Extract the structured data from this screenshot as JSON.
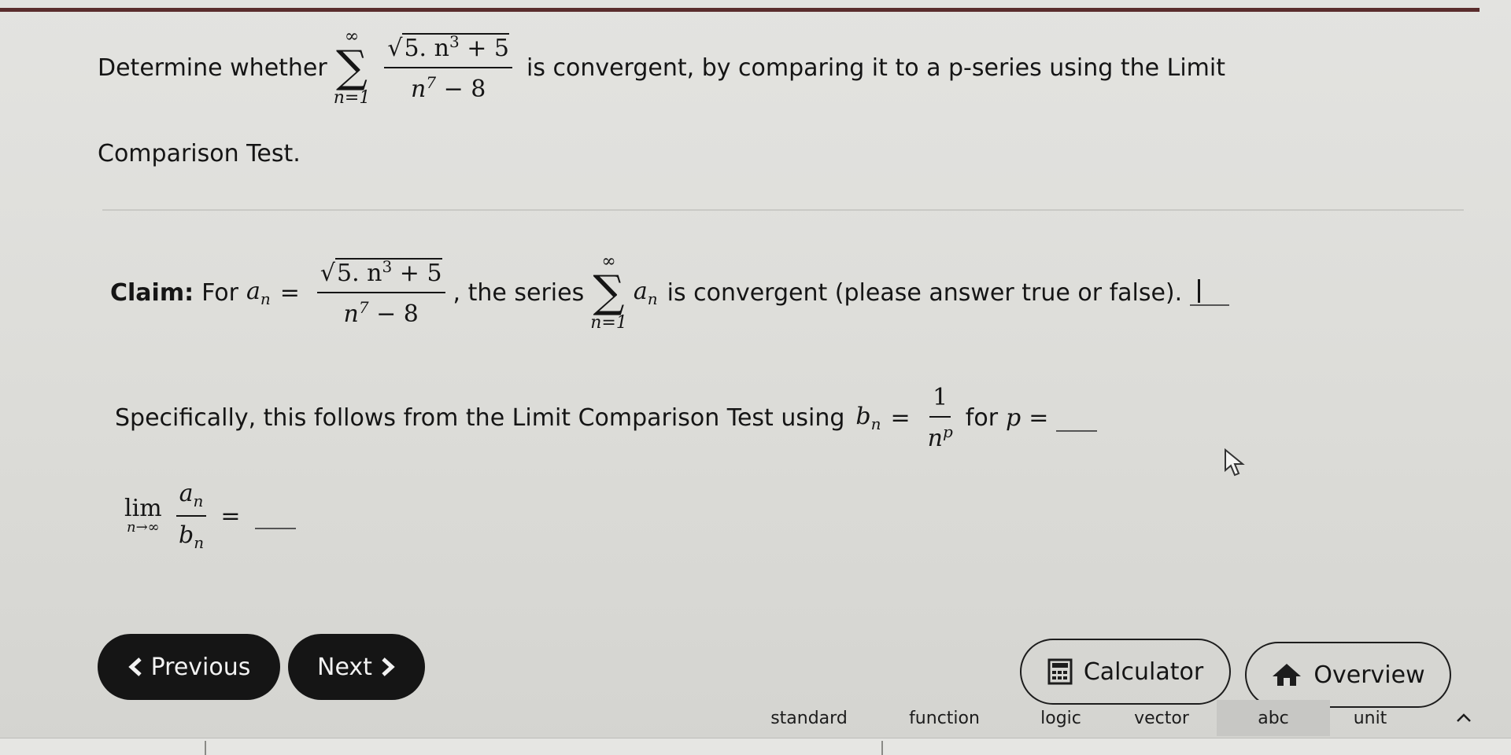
{
  "question": {
    "prefix": "Determine whether",
    "sum_upper": "∞",
    "sum_lower": "n=1",
    "term_numerator": "5. n",
    "term_numerator_exp": "3",
    "term_numerator_tail": " + 5",
    "term_denominator": "n",
    "term_denominator_exp": "7",
    "term_denominator_tail": " − 8",
    "suffix": "is convergent, by comparing it to a p-series using the Limit",
    "line2": "Comparison Test."
  },
  "claim": {
    "label": "Claim:",
    "for_text": "For",
    "a_var": "a",
    "a_sub": "n",
    "equals": "=",
    "numerator": "5. n",
    "numerator_exp": "3",
    "numerator_tail": " + 5",
    "denominator": "n",
    "denominator_exp": "7",
    "denominator_tail": " − 8",
    "series_text": ", the series",
    "sum_upper": "∞",
    "sum_lower": "n=1",
    "series_var": "a",
    "series_sub": "n",
    "tail_text": "is convergent (please answer true or false).",
    "answer_value": ""
  },
  "specific": {
    "text": "Specifically, this follows from the Limit Comparison Test using",
    "b_var": "b",
    "b_sub": "n",
    "equals": "=",
    "numerator": "1",
    "den_var": "n",
    "den_exp": "p",
    "for_text": "for",
    "p_var": "p",
    "p_eq": "=",
    "answer_value": ""
  },
  "limit": {
    "lim": "lim",
    "lim_sub": "n→∞",
    "num_var": "a",
    "num_sub": "n",
    "den_var": "b",
    "den_sub": "n",
    "equals": "=",
    "answer_value": ""
  },
  "nav": {
    "previous_label": "Previous",
    "next_label": "Next"
  },
  "actions": {
    "calculator_label": "Calculator",
    "overview_label": "Overview"
  },
  "keyboard_tabs": [
    "standard",
    "function",
    "logic",
    "vector",
    "abc",
    "unit"
  ],
  "colors": {
    "topline": "#5a2d2d",
    "button_dark": "#151515",
    "background": "#dcdcd9"
  },
  "icons": [
    "chevron-left-icon",
    "chevron-right-icon",
    "calculator-icon",
    "home-icon",
    "chevron-up-icon",
    "mouse-pointer-icon"
  ]
}
